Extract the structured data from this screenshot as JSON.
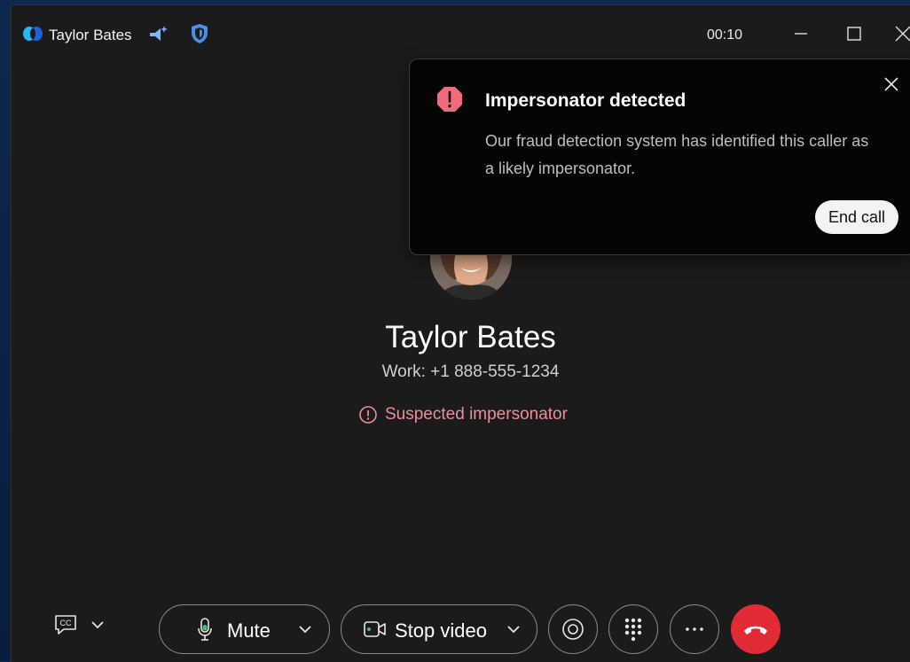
{
  "app": {
    "title": "Taylor Bates",
    "timer": "00:10"
  },
  "toast": {
    "title": "Impersonator detected",
    "body": "Our fraud detection system has identified this caller as a likely impersonator.",
    "end_call_label": "End call",
    "accent_color": "#f06b7b"
  },
  "caller": {
    "name": "Taylor Bates",
    "number": "Work: +1 888-555-1234",
    "warning": "Suspected impersonator",
    "warning_color": "#f08c9a"
  },
  "controls": {
    "mute_label": "Mute",
    "video_label": "Stop video",
    "icons": [
      "captions-icon",
      "microphone-icon",
      "video-camera-icon",
      "record-icon",
      "keypad-icon",
      "more-icon",
      "hang-up-icon"
    ],
    "hangup_color": "#e22b35"
  }
}
